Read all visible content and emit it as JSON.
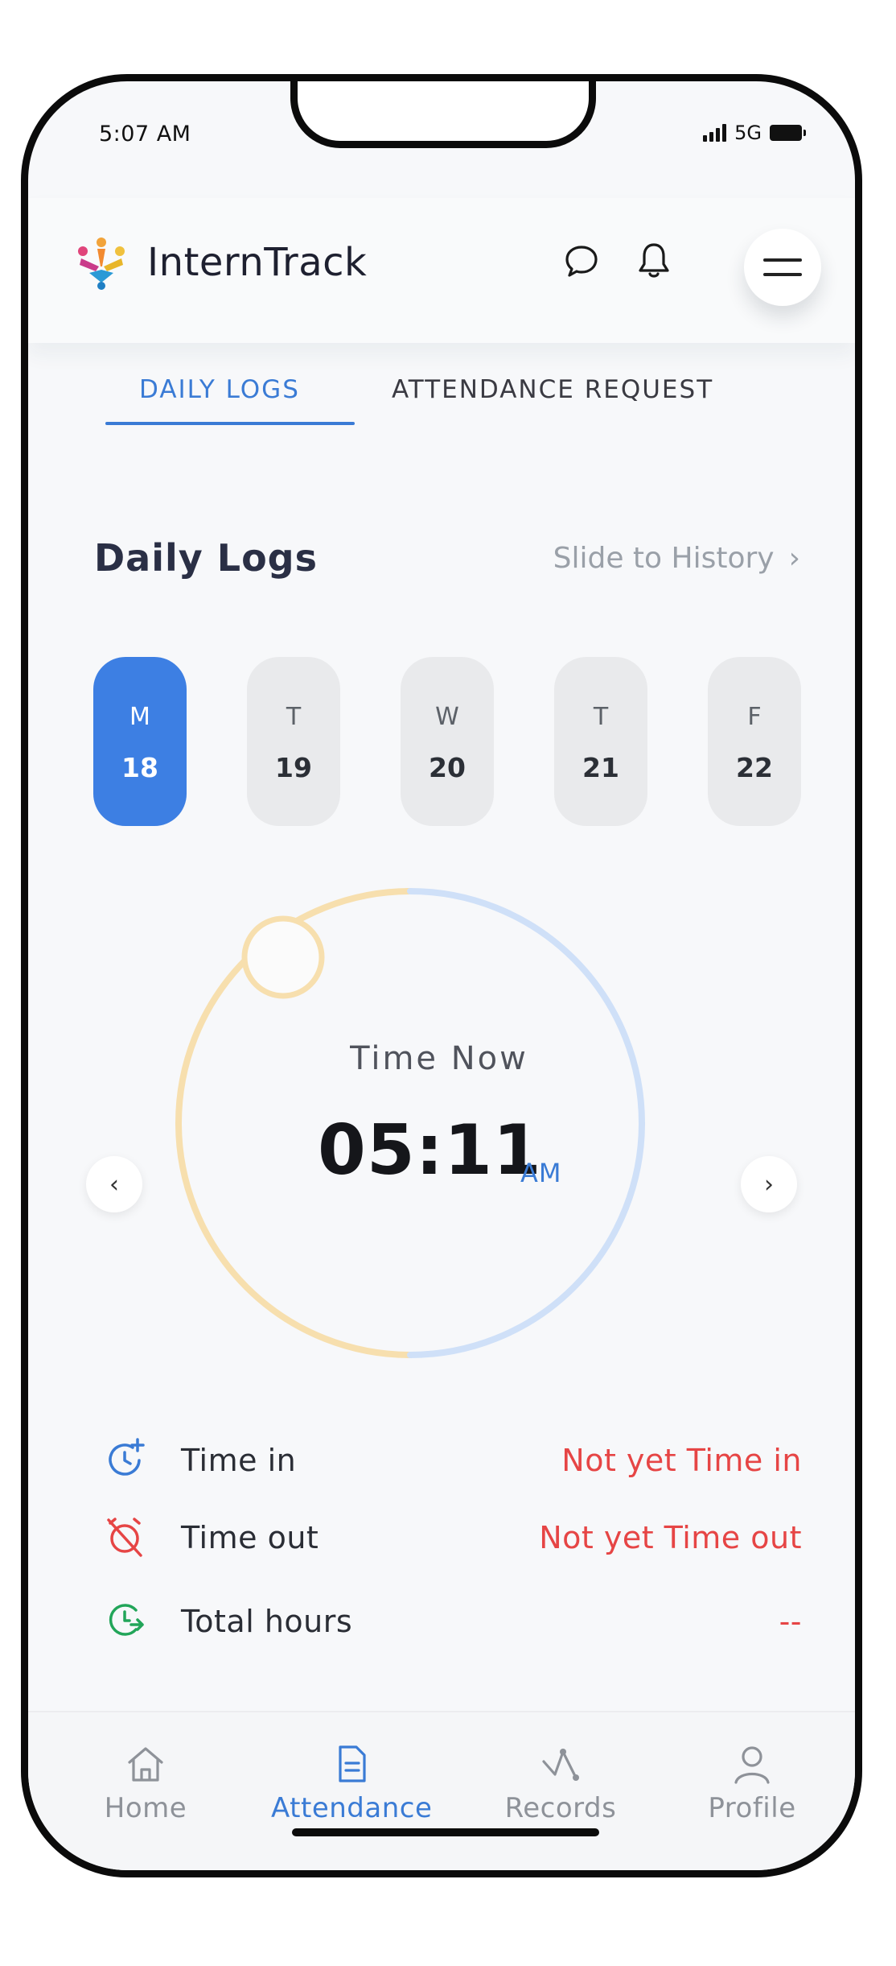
{
  "status_bar": {
    "time": "5:07 AM",
    "network": "5G"
  },
  "header": {
    "app_name": "InternTrack"
  },
  "tabs": [
    {
      "label": "DAILY LOGS",
      "active": true
    },
    {
      "label": "ATTENDANCE REQUEST",
      "active": false
    }
  ],
  "section": {
    "title": "Daily Logs",
    "history_link": "Slide to History"
  },
  "days": [
    {
      "letter": "M",
      "number": "18",
      "selected": true
    },
    {
      "letter": "T",
      "number": "19",
      "selected": false
    },
    {
      "letter": "W",
      "number": "20",
      "selected": false
    },
    {
      "letter": "T",
      "number": "21",
      "selected": false
    },
    {
      "letter": "F",
      "number": "22",
      "selected": false
    }
  ],
  "clock": {
    "label": "Time Now",
    "time": "05:11",
    "ampm": "AM"
  },
  "records": [
    {
      "label": "Time in",
      "value": "Not yet Time in",
      "icon": "clock-plus-icon"
    },
    {
      "label": "Time out",
      "value": "Not yet Time out",
      "icon": "alarm-off-icon"
    },
    {
      "label": "Total hours",
      "value": "--",
      "icon": "clock-forward-icon"
    }
  ],
  "bottom_nav": [
    {
      "label": "Home",
      "icon": "home-icon",
      "active": false
    },
    {
      "label": "Attendance",
      "icon": "document-icon",
      "active": true
    },
    {
      "label": "Records",
      "icon": "graph-icon",
      "active": false
    },
    {
      "label": "Profile",
      "icon": "user-icon",
      "active": false
    }
  ],
  "colors": {
    "accent": "#3a7bd5",
    "selected_day": "#3d7fe3",
    "warning": "#e64545",
    "success": "#22a559",
    "ring_warm": "#f7dfae",
    "ring_cool": "#cfe0f8"
  }
}
